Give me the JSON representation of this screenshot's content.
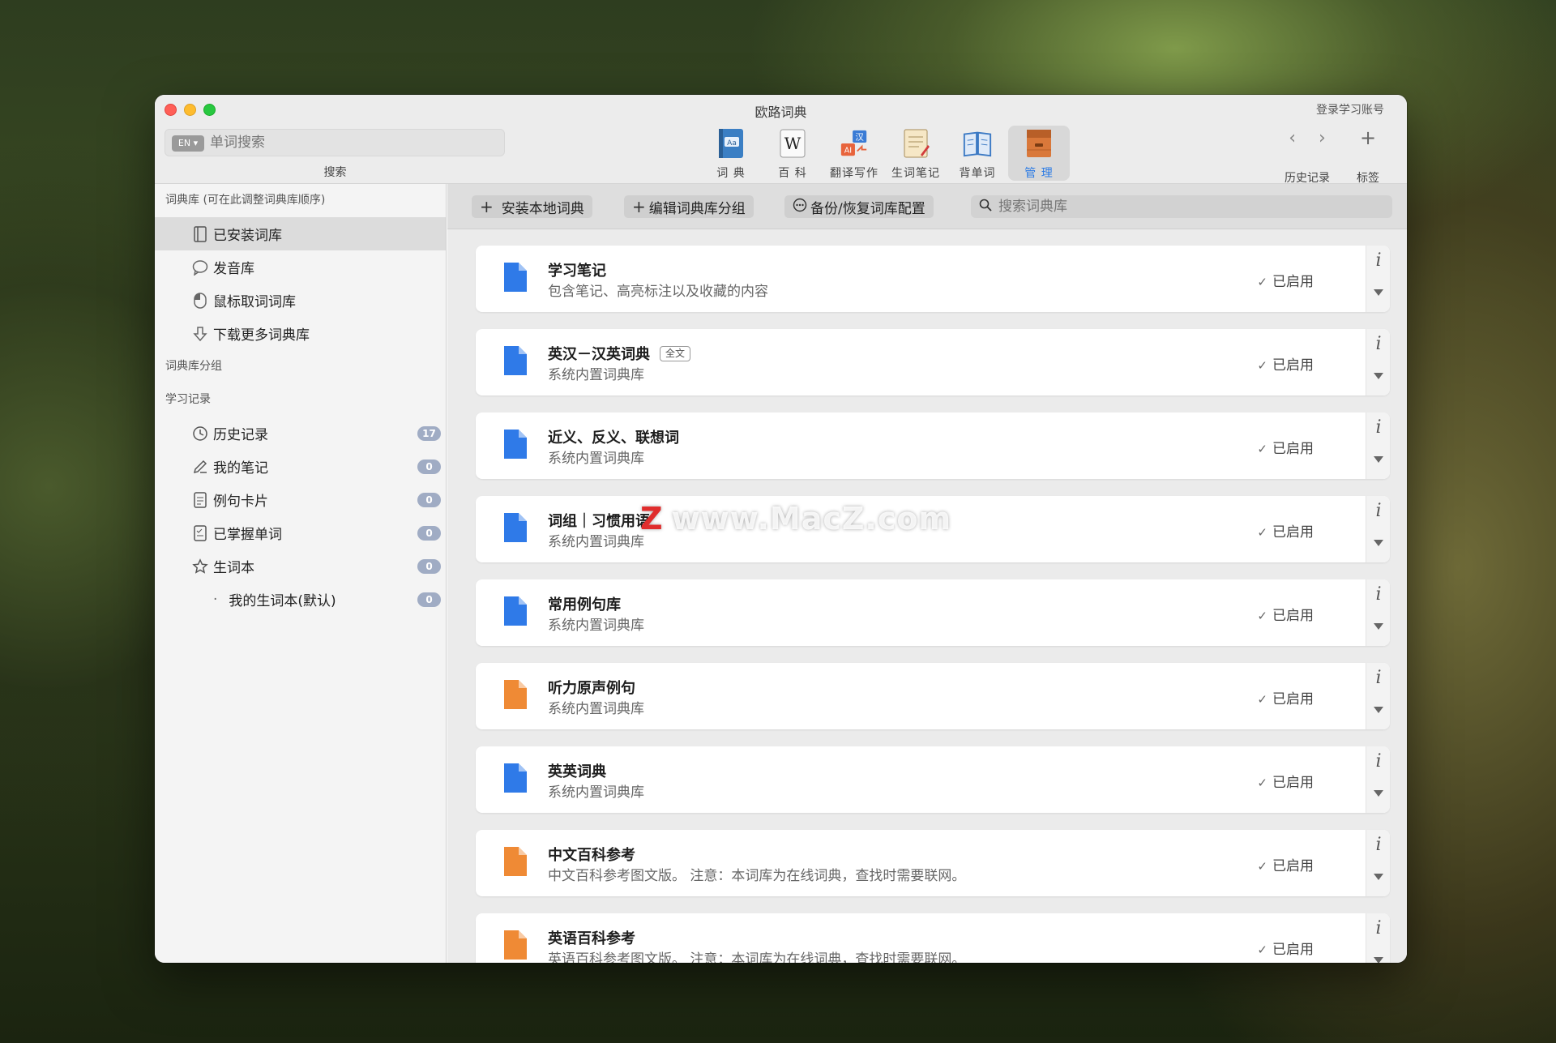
{
  "window": {
    "title": "欧路词典",
    "login_label": "登录学习账号"
  },
  "search": {
    "lang_label": "EN",
    "placeholder": "单词搜索",
    "caption": "搜索"
  },
  "toolbar": {
    "tools": [
      {
        "label": "词 典",
        "icon": "dictionary-icon",
        "active": false
      },
      {
        "label": "百 科",
        "icon": "wikipedia-icon",
        "active": false
      },
      {
        "label": "翻译写作",
        "icon": "translate-icon",
        "active": false
      },
      {
        "label": "生词笔记",
        "icon": "notes-icon",
        "active": false
      },
      {
        "label": "背单词",
        "icon": "book-icon",
        "active": false
      },
      {
        "label": "管 理",
        "icon": "manage-icon",
        "active": true
      }
    ],
    "history_label": "历史记录",
    "bookmark_label": "标签",
    "back_icon": "chevron-left-icon",
    "forward_icon": "chevron-right-icon",
    "add_icon": "plus-icon"
  },
  "sidebar": {
    "library_header": "词典库 (可在此调整词典库顺序)",
    "library_items": [
      {
        "label": "已安装词库",
        "icon": "book-outline-icon",
        "selected": true
      },
      {
        "label": "发音库",
        "icon": "speech-bubble-icon",
        "selected": false
      },
      {
        "label": "鼠标取词词库",
        "icon": "mouse-icon",
        "selected": false
      },
      {
        "label": "下载更多词典库",
        "icon": "download-icon",
        "selected": false
      }
    ],
    "group_header": "词典库分组",
    "study_header": "学习记录",
    "study_items": [
      {
        "label": "历史记录",
        "icon": "clock-icon",
        "count": "17"
      },
      {
        "label": "我的笔记",
        "icon": "pencil-icon",
        "count": "0"
      },
      {
        "label": "例句卡片",
        "icon": "card-icon",
        "count": "0"
      },
      {
        "label": "已掌握单词",
        "icon": "checklist-icon",
        "count": "0"
      },
      {
        "label": "生词本",
        "icon": "star-icon",
        "count": "0"
      }
    ],
    "sub_item": {
      "label": "我的生词本(默认)",
      "count": "0"
    }
  },
  "content_toolbar": {
    "install_label": "安装本地词典",
    "edit_group_label": "编辑词典库分组",
    "backup_label": "备份/恢复词库配置",
    "search_placeholder": "搜索词典库"
  },
  "dictionaries": [
    {
      "name": "学习笔记",
      "desc": "包含笔记、高亮标注以及收藏的内容",
      "status": "已启用",
      "color": "#2f7ae8",
      "tag": ""
    },
    {
      "name": "英汉－汉英词典",
      "desc": "系统内置词典库",
      "status": "已启用",
      "color": "#2f7ae8",
      "tag": "全文"
    },
    {
      "name": "近义、反义、联想词",
      "desc": "系统内置词典库",
      "status": "已启用",
      "color": "#2f7ae8",
      "tag": ""
    },
    {
      "name": "词组｜习惯用语",
      "desc": "系统内置词典库",
      "status": "已启用",
      "color": "#2f7ae8",
      "tag": ""
    },
    {
      "name": "常用例句库",
      "desc": "系统内置词典库",
      "status": "已启用",
      "color": "#2f7ae8",
      "tag": ""
    },
    {
      "name": "听力原声例句",
      "desc": "系统内置词典库",
      "status": "已启用",
      "color": "#ef8a35",
      "tag": ""
    },
    {
      "name": "英英词典",
      "desc": "系统内置词典库",
      "status": "已启用",
      "color": "#2f7ae8",
      "tag": ""
    },
    {
      "name": "中文百科参考",
      "desc": "中文百科参考图文版。 注意：本词库为在线词典，查找时需要联网。",
      "status": "已启用",
      "color": "#ef8a35",
      "tag": ""
    },
    {
      "name": "英语百科参考",
      "desc": "英语百科参考图文版。 注意：本词库为在线词典，查找时需要联网。",
      "status": "已启用",
      "color": "#ef8a35",
      "tag": ""
    }
  ],
  "watermark": {
    "text": "www.MacZ.com",
    "mark": "Z"
  }
}
